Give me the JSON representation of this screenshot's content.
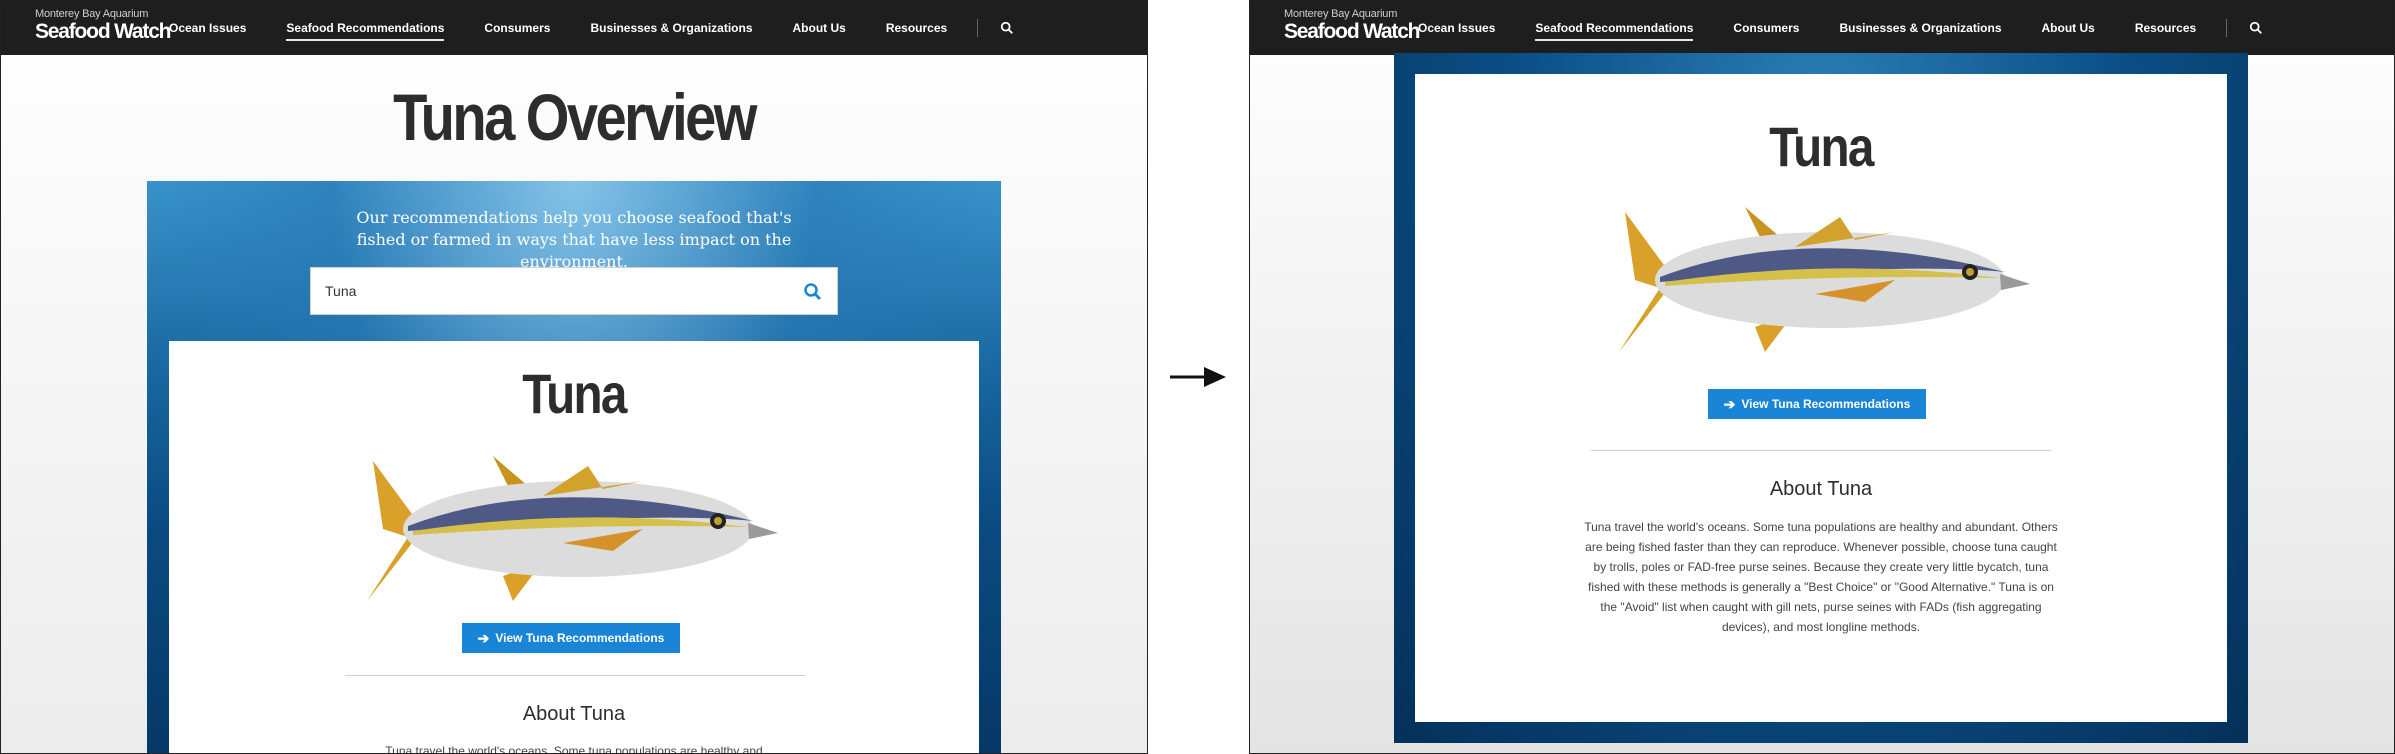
{
  "brand": {
    "top": "Monterey Bay Aquarium",
    "main": "Seafood Watch"
  },
  "nav": {
    "items": [
      {
        "label": "Ocean Issues",
        "active": false
      },
      {
        "label": "Seafood Recommendations",
        "active": true
      },
      {
        "label": "Consumers",
        "active": false
      },
      {
        "label": "Businesses & Organizations",
        "active": false
      },
      {
        "label": "About Us",
        "active": false
      },
      {
        "label": "Resources",
        "active": false
      }
    ],
    "search_icon": "search-icon"
  },
  "left_screen": {
    "page_title": "Tuna Overview",
    "hero_tagline": "Our recommendations help you choose seafood that's fished or farmed in ways that have less impact on the environment.",
    "search": {
      "value": "Tuna",
      "icon": "search-icon"
    },
    "card": {
      "title": "Tuna",
      "cta_label": "View Tuna Recommendations",
      "about_title": "About Tuna",
      "about_text_visible": "Tuna travel the world's oceans. Some tuna populations are healthy and"
    }
  },
  "right_screen": {
    "card": {
      "title": "Tuna",
      "cta_label": "View Tuna Recommendations",
      "about_title": "About Tuna",
      "about_text": "Tuna travel the world's oceans. Some tuna populations are healthy and abundant. Others are being fished faster than they can reproduce. Whenever possible, choose tuna caught by trolls, poles or FAD-free purse seines. Because they create very little bycatch, tuna fished with these methods is generally a \"Best Choice\" or \"Good Alternative.\" Tuna is on the \"Avoid\" list when caught with gill nets, purse seines with FADs (fish aggregating devices), and most longline methods."
    }
  },
  "colors": {
    "navbar": "#1e1e1e",
    "cta": "#1a84d6",
    "hero_blue": "#0b4f86",
    "title_text": "#2d2d2d"
  }
}
